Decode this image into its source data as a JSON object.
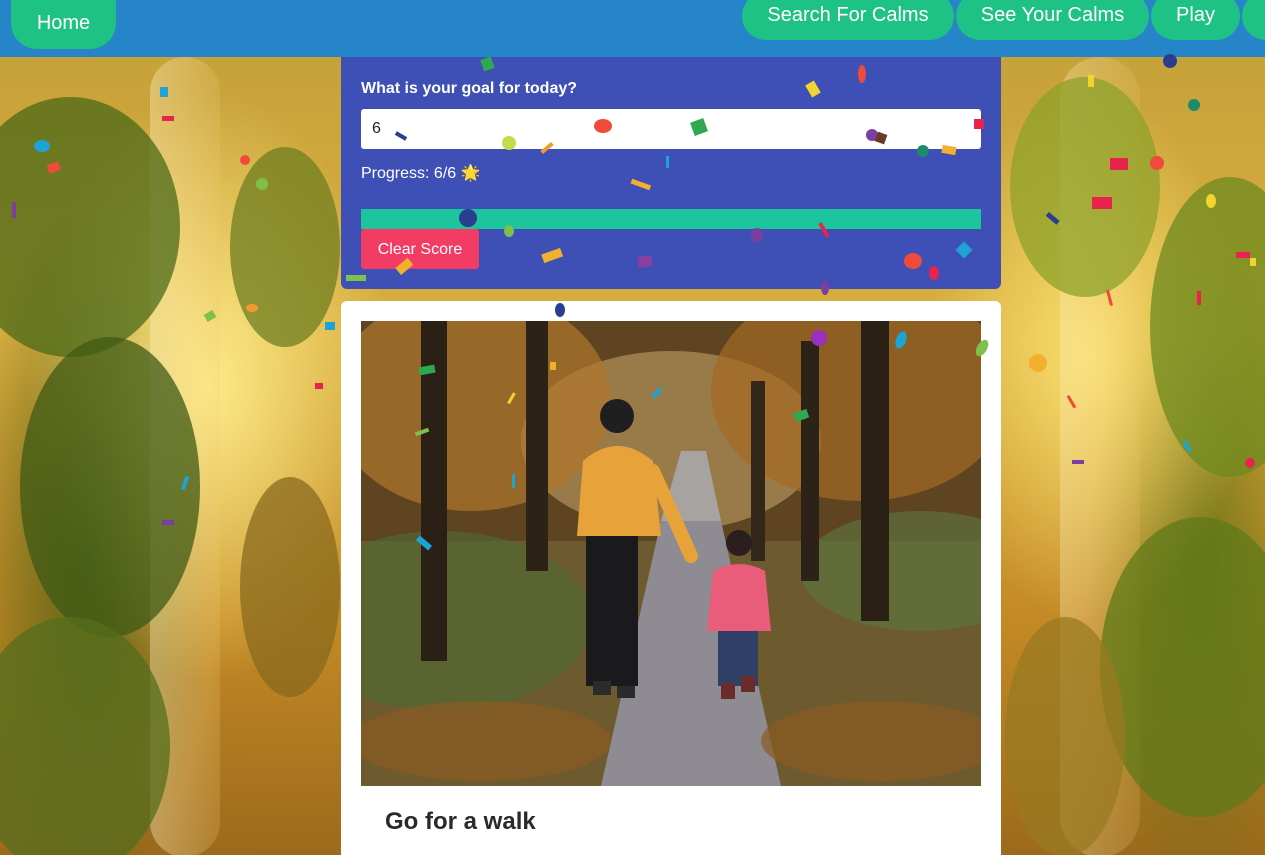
{
  "navbar": {
    "home_label": "Home",
    "search_label": "Search For Calms",
    "see_label": "See Your Calms",
    "play_label": "Play"
  },
  "goal": {
    "question": "What is your goal for today?",
    "input_value": "6",
    "progress_text": "Progress: 6/6 🌟",
    "progress_fraction": 1.0,
    "clear_label": "Clear Score"
  },
  "card": {
    "title": "Go for a walk",
    "image_icon": "walk-photo"
  },
  "colors": {
    "navbar": "#2684c8",
    "nav_button": "#1fc285",
    "panel": "#3e50b6",
    "progress_fill": "#1cc59c",
    "clear_button": "#f23c63"
  }
}
